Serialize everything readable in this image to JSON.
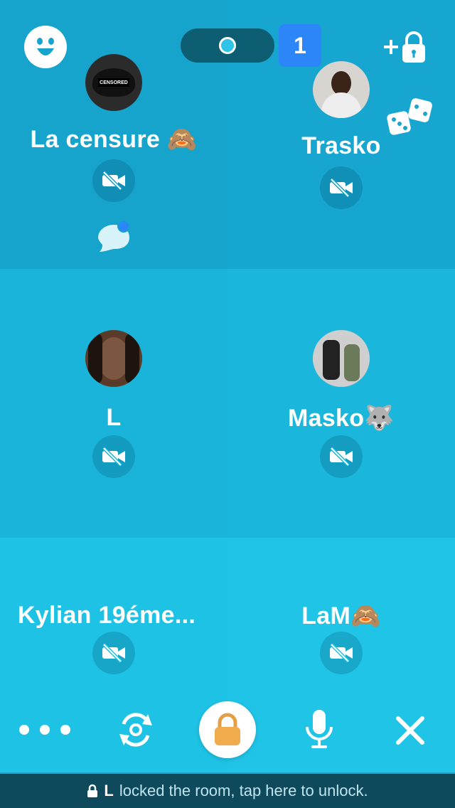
{
  "room": {
    "count_badge": "1"
  },
  "participants": [
    {
      "name": "La censure 🙈",
      "avatar_text": "CENSORED",
      "avatar_color": "#2a2a2a"
    },
    {
      "name": "Trasko",
      "avatar_color": "#d8d4d0"
    },
    {
      "name": "L",
      "avatar_color": "#5a3b2a"
    },
    {
      "name": "Masko🐺",
      "avatar_color": "#cfcfcf"
    },
    {
      "name": "Kylian 19éme...",
      "avatar_color": null
    },
    {
      "name": "LaM🙈",
      "avatar_color": null
    }
  ],
  "footer": {
    "user": "L",
    "message": "locked the room, tap here to unlock."
  },
  "colors": {
    "accent": "#2c86f7",
    "footer_bg": "#0e4a5c",
    "lock_orange": "#f0ab4c"
  },
  "icons": {
    "smiley": "smiley-icon",
    "add_lock": "add-lock-icon",
    "dice": "dice-icon",
    "camera_off": "camera-off-icon",
    "chat": "chat-bubble-icon",
    "more": "more-dots-icon",
    "flip_camera": "flip-camera-icon",
    "lock": "lock-icon",
    "mic": "microphone-icon",
    "close": "close-icon"
  }
}
